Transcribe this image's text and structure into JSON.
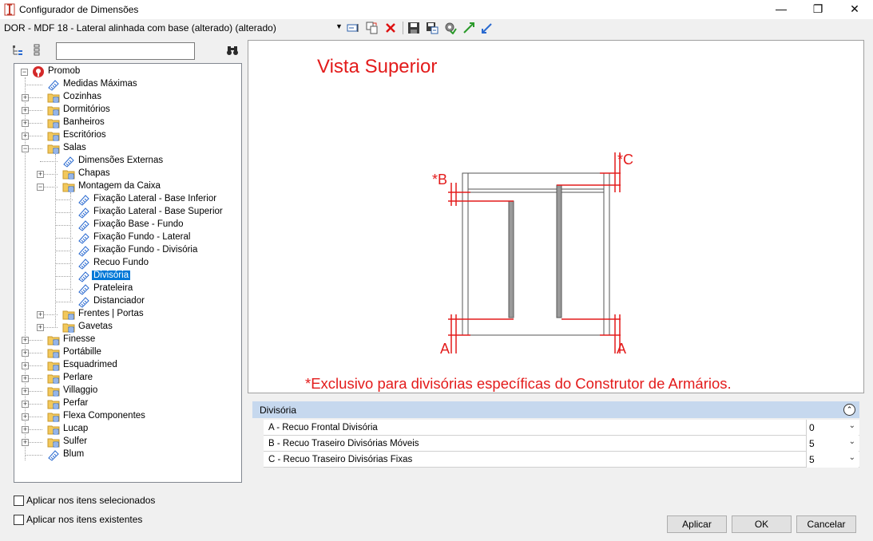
{
  "window": {
    "title": "Configurador de Dimensões",
    "minimize_glyph": "—",
    "maximize_glyph": "❐",
    "close_glyph": "✕"
  },
  "toolbar": {
    "item_selector": "DOR - MDF 18 - Lateral alinhada com base (alterado) (alterado)",
    "icons": [
      "rename-icon",
      "copy-icon",
      "delete-icon",
      "save-icon",
      "save-as-icon",
      "settings-icon",
      "expand-arrows-icon",
      "collapse-arrows-icon"
    ]
  },
  "tree_toolbar": {
    "search_value": "",
    "icons": [
      "tree-view-icon",
      "list-view-icon",
      "binoculars-search-icon"
    ]
  },
  "tree": {
    "root": "Promob",
    "items": [
      {
        "label": "Medidas Máximas"
      },
      {
        "label": "Cozinhas"
      },
      {
        "label": "Dormitórios"
      },
      {
        "label": "Banheiros"
      },
      {
        "label": "Escritórios"
      },
      {
        "label": "Salas"
      },
      {
        "label": "Dimensões Externas"
      },
      {
        "label": "Chapas"
      },
      {
        "label": "Montagem da Caixa"
      },
      {
        "label": "Fixação Lateral - Base Inferior"
      },
      {
        "label": "Fixação Lateral - Base Superior"
      },
      {
        "label": "Fixação Base - Fundo"
      },
      {
        "label": "Fixação Fundo - Lateral"
      },
      {
        "label": "Fixação Fundo - Divisória"
      },
      {
        "label": "Recuo Fundo"
      },
      {
        "label": "Divisória"
      },
      {
        "label": "Prateleira"
      },
      {
        "label": "Distanciador"
      },
      {
        "label": "Frentes | Portas"
      },
      {
        "label": "Gavetas"
      },
      {
        "label": "Finesse"
      },
      {
        "label": "Portábille"
      },
      {
        "label": "Esquadrimed"
      },
      {
        "label": "Perlare"
      },
      {
        "label": "Villaggio"
      },
      {
        "label": "Perfar"
      },
      {
        "label": "Flexa Componentes"
      },
      {
        "label": "Lucap"
      },
      {
        "label": "Sulfer"
      },
      {
        "label": "Blum"
      }
    ]
  },
  "options": {
    "apply_selected": "Aplicar nos itens selecionados",
    "apply_existing": "Aplicar nos itens existentes"
  },
  "preview": {
    "title": "Vista Superior",
    "label_b": "*B",
    "label_c": "*C",
    "label_a_left": "A",
    "label_a_right": "A",
    "footnote": "*Exclusivo para divisórias específicas do Construtor de Armários.",
    "accent_color": "#e31b1b"
  },
  "properties": {
    "section": "Divisória",
    "rows": [
      {
        "label": "A - Recuo Frontal Divisória",
        "value": "0"
      },
      {
        "label": "B - Recuo Traseiro Divisórias Móveis",
        "value": "5"
      },
      {
        "label": "C - Recuo Traseiro Divisórias Fixas",
        "value": "5"
      }
    ]
  },
  "buttons": {
    "apply": "Aplicar",
    "ok": "OK",
    "cancel": "Cancelar"
  }
}
